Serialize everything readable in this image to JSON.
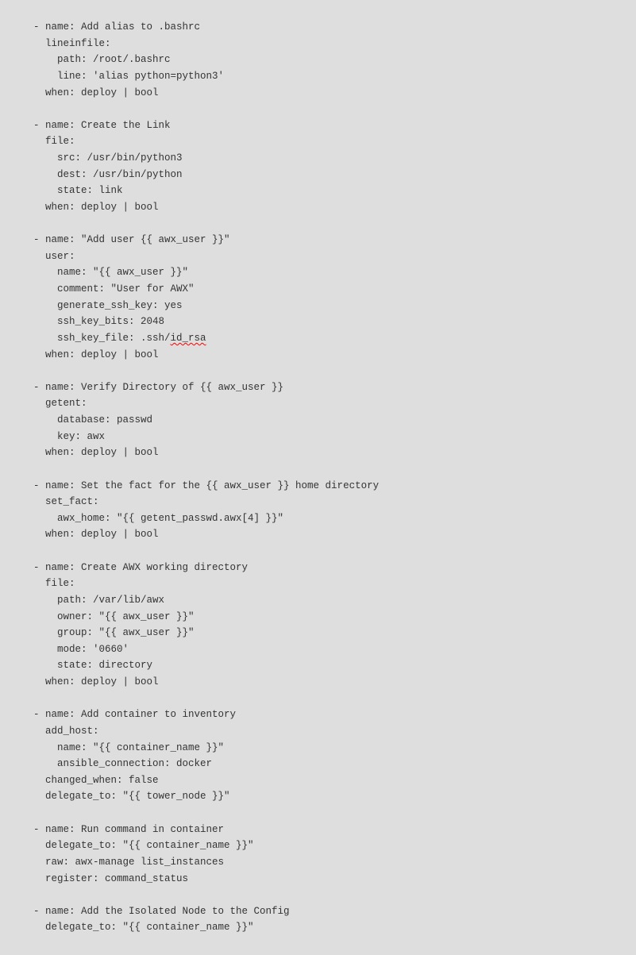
{
  "code_lines": [
    "- name: Add alias to .bashrc",
    "  lineinfile:",
    "    path: /root/.bashrc",
    "    line: 'alias python=python3'",
    "  when: deploy | bool",
    "",
    "- name: Create the Link",
    "  file:",
    "    src: /usr/bin/python3",
    "    dest: /usr/bin/python",
    "    state: link",
    "  when: deploy | bool",
    "",
    "- name: \"Add user {{ awx_user }}\"",
    "  user:",
    "    name: \"{{ awx_user }}\"",
    "    comment: \"User for AWX\"",
    "    generate_ssh_key: yes",
    "    ssh_key_bits: 2048",
    "    ssh_key_file: .ssh/[[SPELL:id_rsa]]",
    "  when: deploy | bool",
    "",
    "- name: Verify Directory of {{ awx_user }}",
    "  getent:",
    "    database: passwd",
    "    key: awx",
    "  when: deploy | bool",
    "",
    "- name: Set the fact for the {{ awx_user }} home directory",
    "  set_fact:",
    "    awx_home: \"{{ getent_passwd.awx[4] }}\"",
    "  when: deploy | bool",
    "",
    "- name: Create AWX working directory",
    "  file:",
    "    path: /var/lib/awx",
    "    owner: \"{{ awx_user }}\"",
    "    group: \"{{ awx_user }}\"",
    "    mode: '0660'",
    "    state: directory",
    "  when: deploy | bool",
    "",
    "- name: Add container to inventory",
    "  add_host:",
    "    name: \"{{ container_name }}\"",
    "    ansible_connection: docker",
    "  changed_when: false",
    "  delegate_to: \"{{ tower_node }}\"",
    "",
    "- name: Run command in container",
    "  delegate_to: \"{{ container_name }}\"",
    "  raw: awx-manage list_instances",
    "  register: command_status",
    "",
    "- name: Add the Isolated Node to the Config",
    "  delegate_to: \"{{ container_name }}\""
  ]
}
